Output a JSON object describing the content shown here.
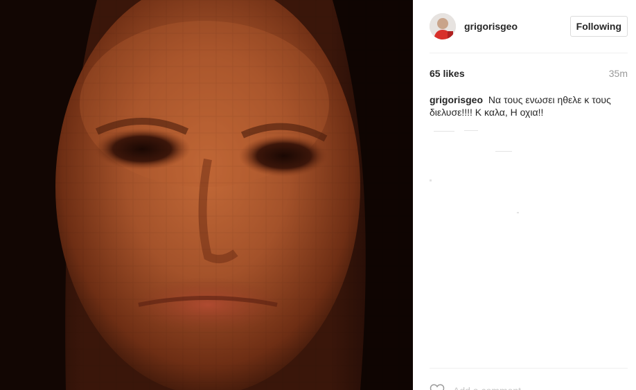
{
  "post": {
    "media": {
      "alt_icon": "photo",
      "palette": {
        "dark": "#1b0904",
        "skin_mid": "#9a4a22",
        "skin_light": "#c46a38",
        "shadow": "#5a2410",
        "lip": "#a3402a",
        "hair": "#120603"
      }
    },
    "header": {
      "username": "grigorisgeo",
      "follow_label": "Following"
    },
    "stats": {
      "likes": "65 likes",
      "time_ago": "35m"
    },
    "caption": {
      "author": "grigorisgeo",
      "text": "Να τους ενωσει ηθελε κ τους διελυσε!!!! Κ καλα, Η οχια!!"
    },
    "footer": {
      "like_icon": "heart-icon",
      "comment_placeholder": "Add a comment..."
    },
    "colors": {
      "text": "#262626",
      "muted": "#999999",
      "border": "#dbdbdb",
      "divider": "#efefef"
    }
  }
}
